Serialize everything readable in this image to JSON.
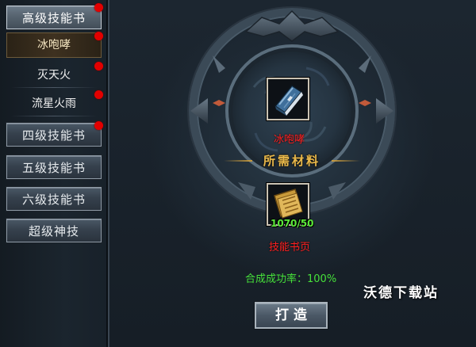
{
  "sidebar": {
    "categories": [
      {
        "label": "高级技能书",
        "has_notification": true
      },
      {
        "label": "四级技能书",
        "has_notification": true
      },
      {
        "label": "五级技能书",
        "has_notification": false
      },
      {
        "label": "六级技能书",
        "has_notification": false
      },
      {
        "label": "超级神技",
        "has_notification": false
      }
    ],
    "sub_items": [
      {
        "label": "冰咆哮",
        "selected": true,
        "has_notification": true
      },
      {
        "label": "灭天火",
        "selected": false,
        "has_notification": true
      },
      {
        "label": "流星火雨",
        "selected": false,
        "has_notification": true
      }
    ]
  },
  "craft": {
    "target_item": {
      "name": "冰咆哮",
      "icon": "blue-skill-book-icon"
    },
    "materials_header": "所需材料",
    "material": {
      "name": "技能书页",
      "count": "1070/50",
      "icon": "skill-book-page-scroll-icon"
    },
    "success_rate": "合成成功率：100%",
    "craft_button_label": "打造"
  },
  "watermark": "沃德下载站",
  "colors": {
    "notification_dot": "#e20000",
    "item_name": "#ff2020",
    "success_text": "#46e23a",
    "header_gold": "#e9b94c"
  }
}
